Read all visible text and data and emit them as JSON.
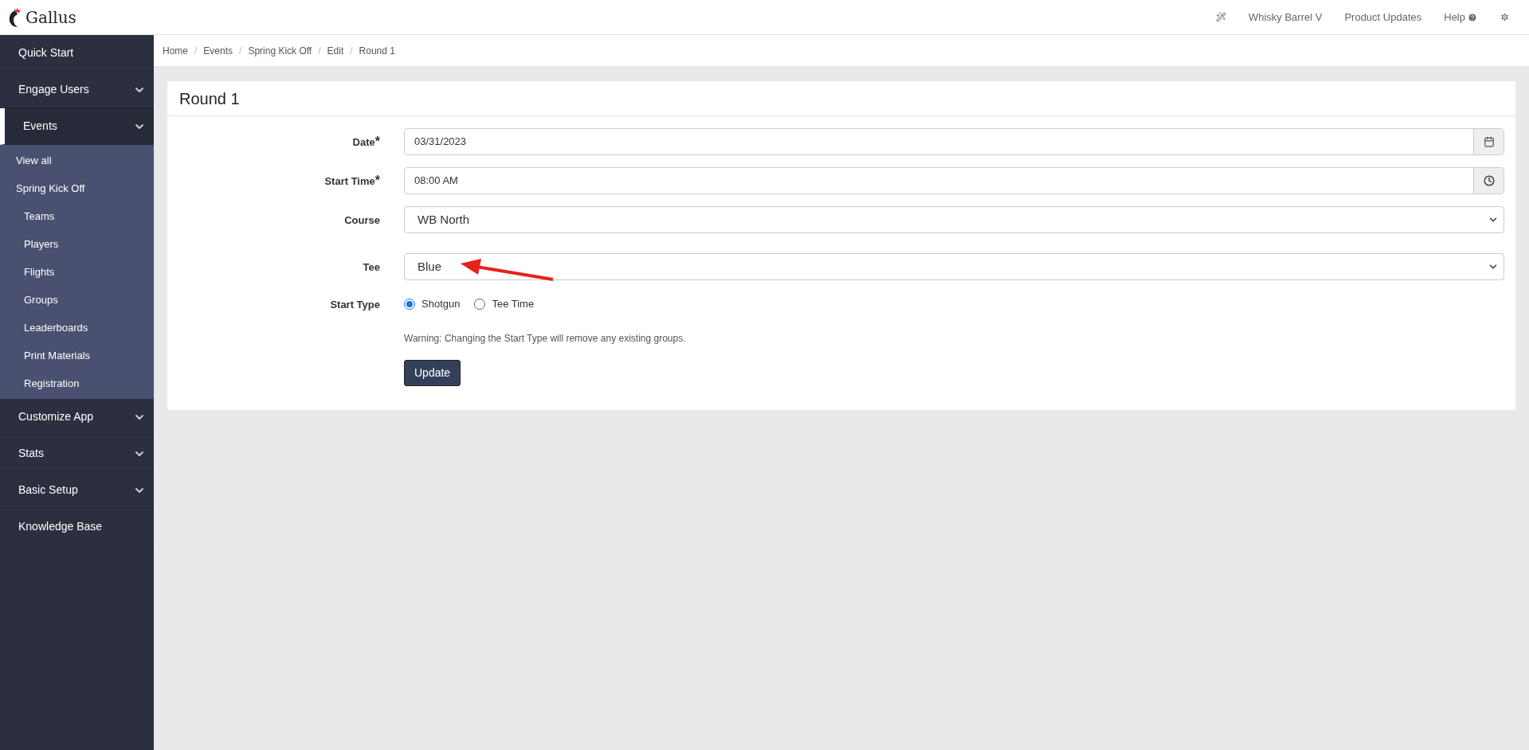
{
  "brand": {
    "name": "Gallus"
  },
  "top_nav": [
    {
      "kind": "icon"
    },
    {
      "kind": "text",
      "label": "Whisky Barrel V"
    },
    {
      "kind": "text",
      "label": "Product Updates"
    },
    {
      "kind": "help",
      "label": "Help"
    },
    {
      "kind": "settings"
    }
  ],
  "sidebar": {
    "items": [
      {
        "label": "Quick Start",
        "expandable": false,
        "selected": false
      },
      {
        "label": "Engage Users",
        "expandable": true,
        "selected": false
      },
      {
        "label": "Events",
        "expandable": true,
        "selected": true,
        "children": [
          {
            "label": "View all"
          },
          {
            "label": "Spring Kick Off",
            "children": [
              {
                "label": "Teams"
              },
              {
                "label": "Players"
              },
              {
                "label": "Flights"
              },
              {
                "label": "Groups"
              },
              {
                "label": "Leaderboards"
              },
              {
                "label": "Print Materials"
              },
              {
                "label": "Registration"
              }
            ]
          }
        ]
      },
      {
        "label": "Customize App",
        "expandable": true,
        "selected": false
      },
      {
        "label": "Stats",
        "expandable": true,
        "selected": false
      },
      {
        "label": "Basic Setup",
        "expandable": true,
        "selected": false
      },
      {
        "label": "Knowledge Base",
        "expandable": false,
        "selected": false
      }
    ]
  },
  "breadcrumb": [
    {
      "kind": "link",
      "label": "Home"
    },
    {
      "kind": "separator",
      "label": "/"
    },
    {
      "kind": "link",
      "label": "Events"
    },
    {
      "kind": "separator",
      "label": "/"
    },
    {
      "kind": "link",
      "label": "Spring Kick Off"
    },
    {
      "kind": "separator",
      "label": "/"
    },
    {
      "kind": "link",
      "label": "Edit"
    },
    {
      "kind": "separator",
      "label": "/"
    },
    {
      "kind": "link",
      "label": "Round 1"
    }
  ],
  "card": {
    "title": "Round 1",
    "fields": [
      {
        "kind": "date",
        "label": "Date",
        "required_mark": "*",
        "value": "03/31/2023"
      },
      {
        "kind": "time",
        "label": "Start Time",
        "required_mark": "*",
        "value": "08:00 AM"
      },
      {
        "kind": "select",
        "label": "Course",
        "value": "WB North",
        "annotated": false
      },
      {
        "kind": "select",
        "label": "Tee",
        "value": "Blue",
        "annotated": true
      },
      {
        "kind": "radio",
        "label": "Start Type",
        "options": [
          {
            "label": "Shotgun",
            "selected": true
          },
          {
            "label": "Tee Time",
            "selected": false
          }
        ]
      }
    ],
    "warning": "Warning: Changing the Start Type will remove any existing groups.",
    "button": "Update"
  }
}
